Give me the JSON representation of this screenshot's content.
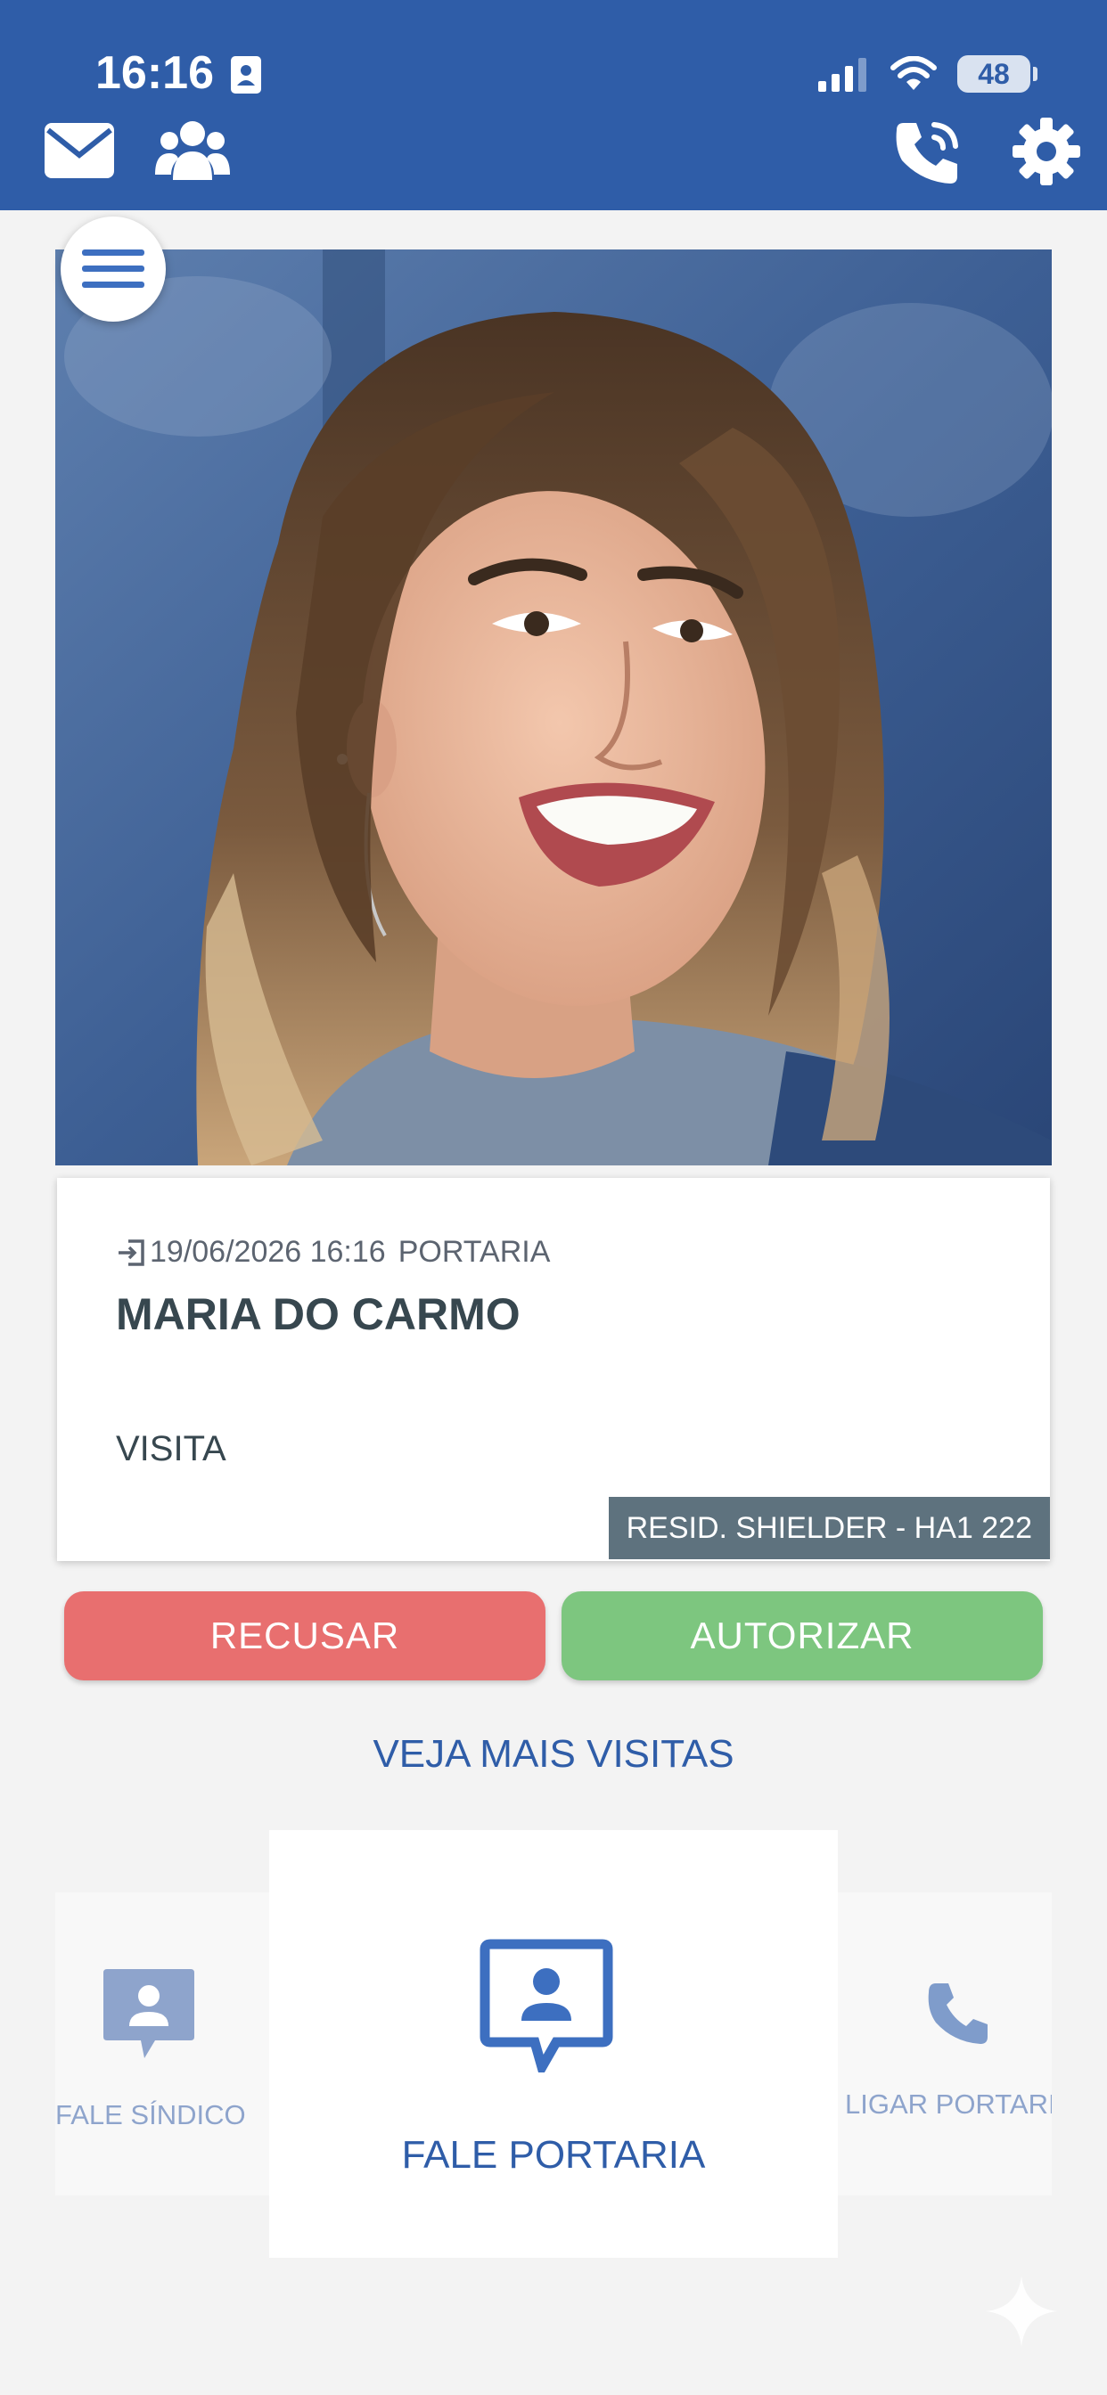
{
  "status_bar": {
    "time": "16:16",
    "battery": "48",
    "icons": [
      "contact-card-icon",
      "signal-icon",
      "wifi-icon",
      "battery-icon"
    ]
  },
  "toolbar": {
    "icons": [
      "mail-icon",
      "group-icon",
      "phone-ringing-icon",
      "gear-icon"
    ]
  },
  "visit": {
    "entry_datetime": "19/06/2026 16:16",
    "entry_source": "PORTARIA",
    "visitor_name": "MARIA DO CARMO",
    "type": "VISITA",
    "residence": "RESID. SHIELDER - HA1 222"
  },
  "actions": {
    "refuse_label": "RECUSAR",
    "authorize_label": "AUTORIZAR",
    "more_visits_label": "VEJA MAIS VISITAS"
  },
  "shortcuts": {
    "left_label": "FALE SÍNDICO",
    "center_label": "FALE PORTARIA",
    "right_label": "LIGAR PORTARI"
  },
  "colors": {
    "primary": "#2f5da8",
    "refuse": "#e86f6f",
    "authorize": "#7dc67f",
    "badge": "#5e727e",
    "text_dark": "#37474f"
  }
}
